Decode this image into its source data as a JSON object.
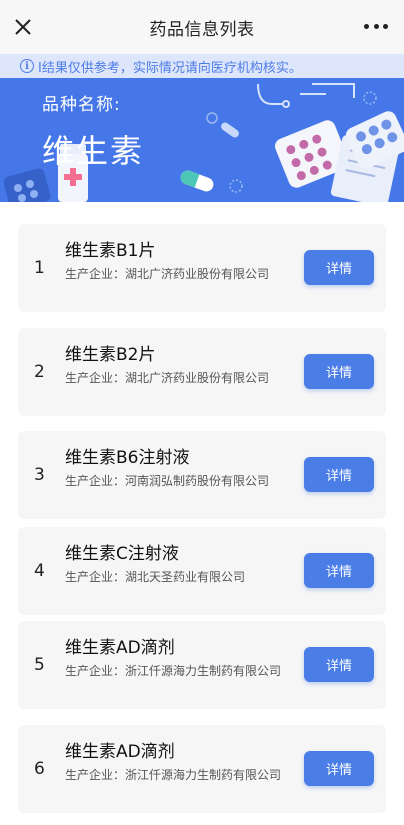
{
  "header": {
    "title": "药品信息列表",
    "close_icon": "close-icon",
    "more_icon": "more-dots-icon"
  },
  "notice": {
    "icon": "info-icon",
    "icon_glyph": "i",
    "text": "I结果仅供参考，实际情况请向医疗机构核实。"
  },
  "banner": {
    "label": "品种名称:",
    "name": "维生素"
  },
  "drugs": [
    {
      "index": "1",
      "name": "维生素B1片",
      "company": "生产企业：湖北广济药业股份有限公司",
      "button": "详情"
    },
    {
      "index": "2",
      "name": "维生素B2片",
      "company": "生产企业：湖北广济药业股份有限公司",
      "button": "详情"
    },
    {
      "index": "3",
      "name": "维生素B6注射液",
      "company": "生产企业：河南润弘制药股份有限公司",
      "button": "详情"
    },
    {
      "index": "4",
      "name": "维生素C注射液",
      "company": "生产企业：湖北天圣药业有限公司",
      "button": "详情"
    },
    {
      "index": "5",
      "name": "维生素AD滴剂",
      "company": "生产企业：浙江仟源海力生制药有限公司",
      "button": "详情"
    },
    {
      "index": "6",
      "name": "维生素AD滴剂",
      "company": "生产企业：浙江仟源海力生制药有限公司",
      "button": "详情"
    }
  ],
  "colors": {
    "accent": "#4a7de6",
    "banner": "#4677e8",
    "notice_bg": "#dde6fb",
    "notice_text": "#4e7ce6",
    "card_bg": "#f6f6f6"
  }
}
